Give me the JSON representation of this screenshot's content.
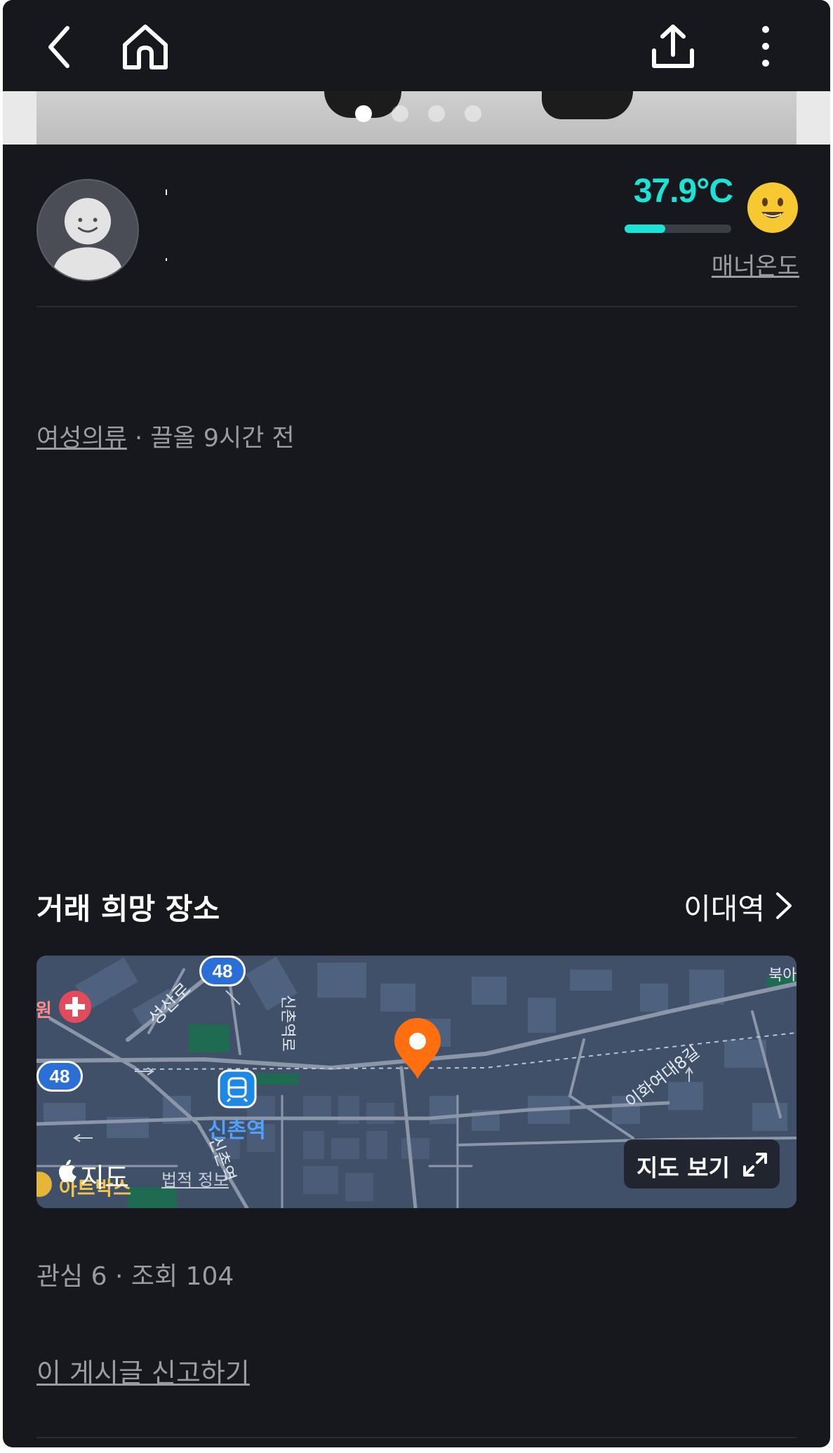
{
  "colors": {
    "background": "#17181d",
    "temperature_accent": "#1be3d6",
    "secondary_text": "#9a9ca3",
    "pin": "#ff6f0f",
    "map_base": "#3f5068",
    "route_badge": "#2a6fd6"
  },
  "topbar": {
    "icons": [
      "back-icon",
      "home-icon",
      "share-icon",
      "more-icon"
    ]
  },
  "carousel": {
    "total": 4,
    "active_index": 0
  },
  "seller": {
    "avatar_icon": "default-avatar",
    "manner_temperature": "37.9°C",
    "temperature_fill": 0.379,
    "temperature_face": "smiling-face-icon",
    "manner_label": "매너온도"
  },
  "post": {
    "category": "여성의류",
    "separator": " · ",
    "bump_info": "끌올 9시간 전"
  },
  "place": {
    "title": "거래 희망 장소",
    "location": "이대역"
  },
  "map": {
    "labels": {
      "route_1": "48",
      "route_2": "48",
      "road_seongsan": "성산로",
      "road_sinchon_a": "신촌역로",
      "road_ewha": "이화여대8길",
      "station": "신촌역",
      "road_sinchon_b": "신촌역",
      "edge_left": "원",
      "edge_right": "북아",
      "poi_artbox": "아트박스",
      "brand": "지도",
      "legal": "법적 정보"
    },
    "view_button": "지도 보기"
  },
  "stats": "관심 6 · 조회 104",
  "report_link": "이 게시글 신고하기"
}
